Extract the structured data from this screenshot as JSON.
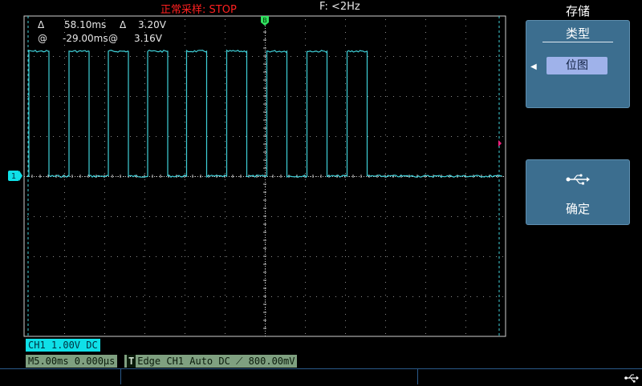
{
  "status": {
    "mode": "正常采样",
    "state": "STOP",
    "color_mode": "#ff2020"
  },
  "frequency": "F: <2Hz",
  "cursor_readout": {
    "delta_symbol": "Δ",
    "delta_time": "58.10ms",
    "delta_v_symbol": "Δ",
    "delta_v": "3.20V",
    "at_symbol": "@",
    "at_time": "-29.00ms",
    "at_v_symbol": "@",
    "at_v": "3.16V"
  },
  "trigger_marker": "B",
  "channel_marker": "1",
  "channel_info": "CH1  1.00V  DC",
  "timebase": "M5.00ms  0.000μs",
  "trigger_info": {
    "badge": "T",
    "text": "Edge  CH1  Auto  DC ⟋  800.00mV"
  },
  "menu": {
    "title": "存储",
    "type_label": "类型",
    "type_value": "位图",
    "confirm_label": "确定",
    "usb_icon": "usb-icon"
  },
  "colors": {
    "trace": "#3fd0d8",
    "grid": "#8a8a8a",
    "panel": "#3c6e8f",
    "channel": "#0fe0e8",
    "trigger_chip": "#7fa080",
    "trigger_level": "#ff2080",
    "cursor": "#30e060"
  },
  "waveform": {
    "channel": "CH1",
    "type": "square",
    "high_v": 3.16,
    "low_v": 0.0,
    "high_segments_div": [
      [
        0.12,
        0.62
      ],
      [
        1.12,
        1.62
      ],
      [
        2.1,
        2.6
      ],
      [
        3.08,
        3.58
      ],
      [
        4.05,
        4.55
      ],
      [
        5.05,
        5.55
      ],
      [
        6.05,
        6.55
      ],
      [
        7.05,
        7.55
      ],
      [
        8.05,
        8.55
      ]
    ]
  }
}
